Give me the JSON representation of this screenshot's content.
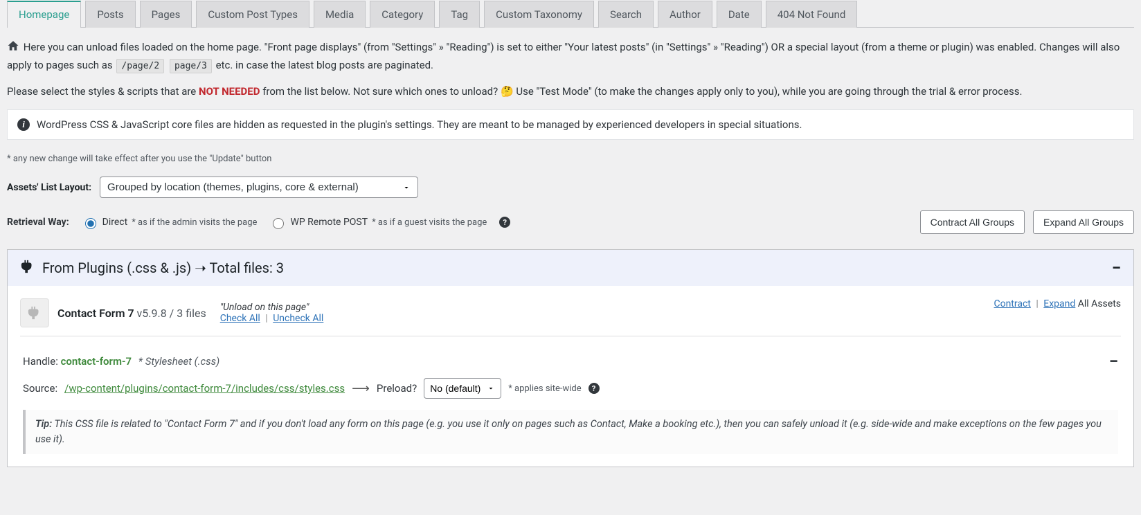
{
  "tabs": [
    "Homepage",
    "Posts",
    "Pages",
    "Custom Post Types",
    "Media",
    "Category",
    "Tag",
    "Custom Taxonomy",
    "Search",
    "Author",
    "Date",
    "404 Not Found"
  ],
  "intro": {
    "line1a": "Here you can unload files loaded on the home page. \"Front page displays\" (from \"Settings\" » \"Reading\") is set to either \"Your latest posts\" (in \"Settings\" » \"Reading\") OR a special layout (from a theme or plugin) was enabled. Changes will also apply to pages such as",
    "code1": "/page/2",
    "code2": "page/3",
    "line1b": "etc. in case the latest blog posts are paginated.",
    "line2a": "Please select the styles & scripts that are",
    "not_needed": "NOT NEEDED",
    "line2b": "from the list below. Not sure which ones to unload?",
    "emoji": "🤔",
    "line2c": "Use \"Test Mode\" (to make the changes apply only to you), while you are going through the trial & error process."
  },
  "info_box": "WordPress CSS & JavaScript core files are hidden as requested in the plugin's settings. They are meant to be managed by experienced developers in special situations.",
  "small_note": "* any new change will take effect after you use the \"Update\" button",
  "layout": {
    "label": "Assets' List Layout:",
    "value": "Grouped by location (themes, plugins, core & external)"
  },
  "retrieval": {
    "label": "Retrieval Way:",
    "opt1": "Direct",
    "opt1_hint": "* as if the admin visits the page",
    "opt2": "WP Remote POST",
    "opt2_hint": "* as if a guest visits the page"
  },
  "buttons": {
    "contract": "Contract All Groups",
    "expand": "Expand All Groups"
  },
  "section": {
    "title": "From Plugins (.css & .js) ➝ Total files: 3"
  },
  "plugin": {
    "name": "Contact Form 7",
    "version": "v5.9.8 / 3 files",
    "quote": "\"Unload on this page\"",
    "check_all": "Check All",
    "uncheck_all": "Uncheck All",
    "contract": "Contract",
    "expand": "Expand",
    "all_assets": "All Assets"
  },
  "handle": {
    "label": "Handle:",
    "name": "contact-form-7",
    "type": "* Stylesheet (.css)"
  },
  "source": {
    "label": "Source:",
    "path": "/wp-content/plugins/contact-form-7/includes/css/styles.css",
    "preload_label": "Preload?",
    "preload_value": "No (default)",
    "applies": "* applies site-wide"
  },
  "tip": {
    "label": "Tip:",
    "text": "This CSS file is related to \"Contact Form 7\" and if you don't load any form on this page (e.g. you use it only on pages such as Contact, Make a booking etc.), then you can safely unload it (e.g. side-wide and make exceptions on the few pages you use it)."
  }
}
